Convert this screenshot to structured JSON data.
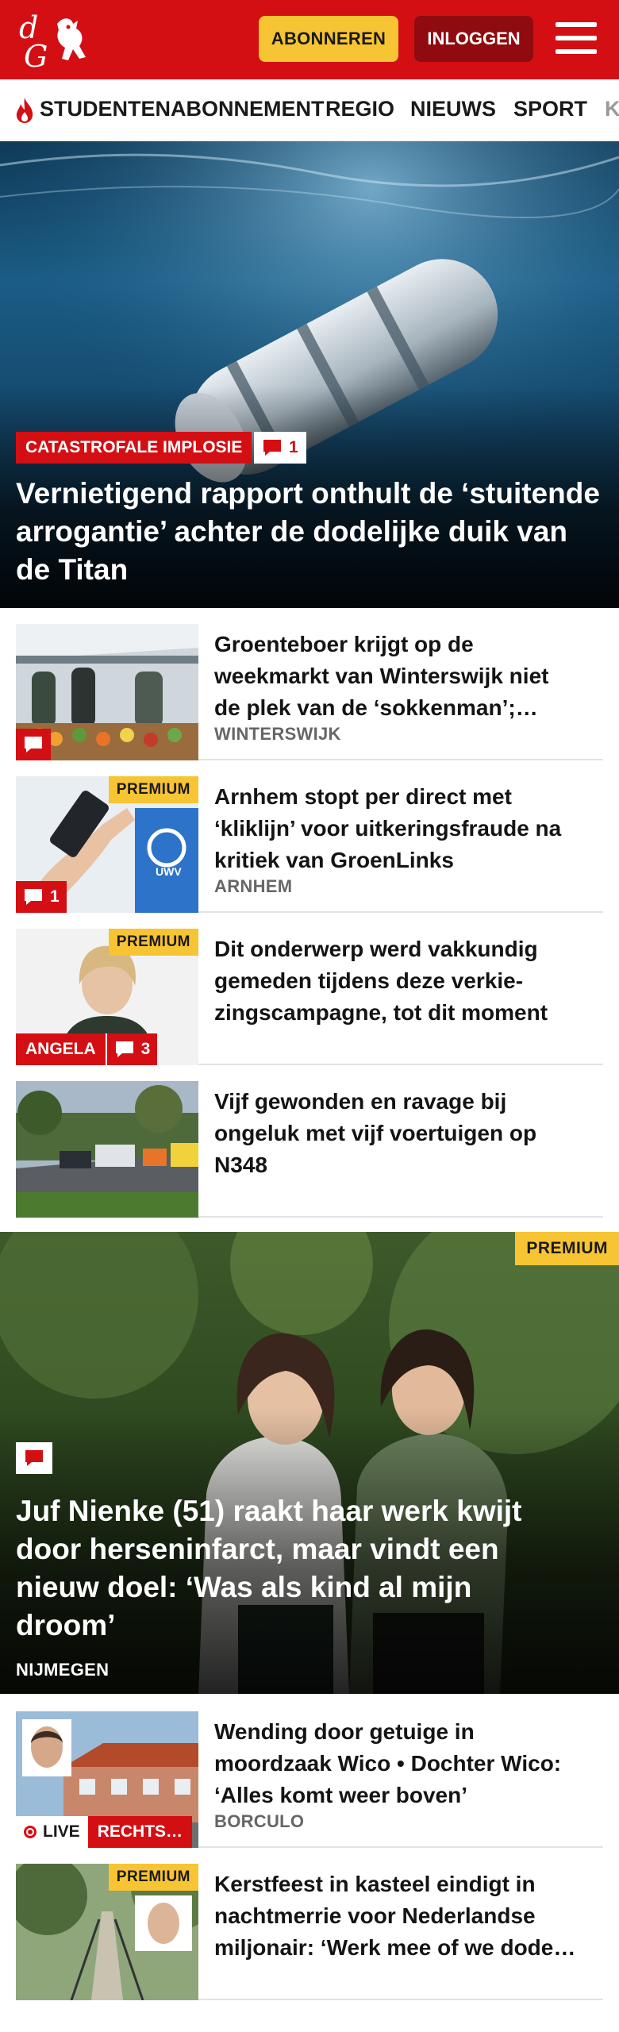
{
  "header": {
    "logo_text": "dG",
    "subscribe_label": "ABONNEREN",
    "login_label": "INLOGGEN"
  },
  "nav": {
    "items": [
      {
        "label": "STUDENTENABONNEMENT",
        "icon": "flame-icon"
      },
      {
        "label": "REGIO"
      },
      {
        "label": "NIEUWS"
      },
      {
        "label": "SPORT"
      },
      {
        "label": "K"
      }
    ]
  },
  "hero": {
    "tag": "CATASTROFALE IMPLOSIE",
    "comments": "1",
    "title": "Vernietigend rapport onthult de ‘stuitende arrogantie’ achter de dodelijke duik van de Titan"
  },
  "articles": [
    {
      "title_lines": [
        "Groenteboer krijgt op de",
        "weekmarkt van Winterswijk niet",
        "de plek van de ‘sokkenman’;…"
      ],
      "location": "WINTERSWIJK",
      "comments": ""
    },
    {
      "title_lines": [
        "Arnhem stopt per direct met",
        "‘kliklijn’ voor uitkeringsfraude na",
        "kritiek van GroenLinks"
      ],
      "location": "ARNHEM",
      "comments": "1",
      "premium": "PREMIUM"
    },
    {
      "title_lines": [
        "Dit onderwerp werd vakkundig",
        "gemeden tijdens deze verkie-",
        "zingscampagne, tot dit moment"
      ],
      "label": "ANGELA",
      "comments": "3",
      "premium": "PREMIUM"
    },
    {
      "title_lines": [
        "Vijf gewonden en ravage bij",
        "ongeluk met vijf voertuigen op",
        "N348"
      ]
    }
  ],
  "hero2": {
    "premium": "PREMIUM",
    "title_lines": [
      "Juf Nienke (51) raakt haar werk kwijt",
      "door herseninfarct, maar vindt een",
      "nieuw doel: ‘Was als kind al mijn",
      "droom’"
    ],
    "location": "NIJMEGEN"
  },
  "articles2": [
    {
      "title_lines": [
        "Wending door getuige in",
        "moordzaak Wico • Dochter Wico:",
        "‘Alles komt weer boven’"
      ],
      "location": "BORCULO",
      "live": "LIVE",
      "label": "RECHTS…"
    },
    {
      "title_lines": [
        "Kerstfeest in kasteel eindigt in",
        "nachtmerrie voor Nederlandse",
        "miljonair: ‘Werk mee of we dode…"
      ],
      "premium": "PREMIUM"
    }
  ],
  "colors": {
    "brand_red": "#d40f14",
    "premium_yellow": "#f7c433",
    "dark_red": "#8f0b0f"
  }
}
